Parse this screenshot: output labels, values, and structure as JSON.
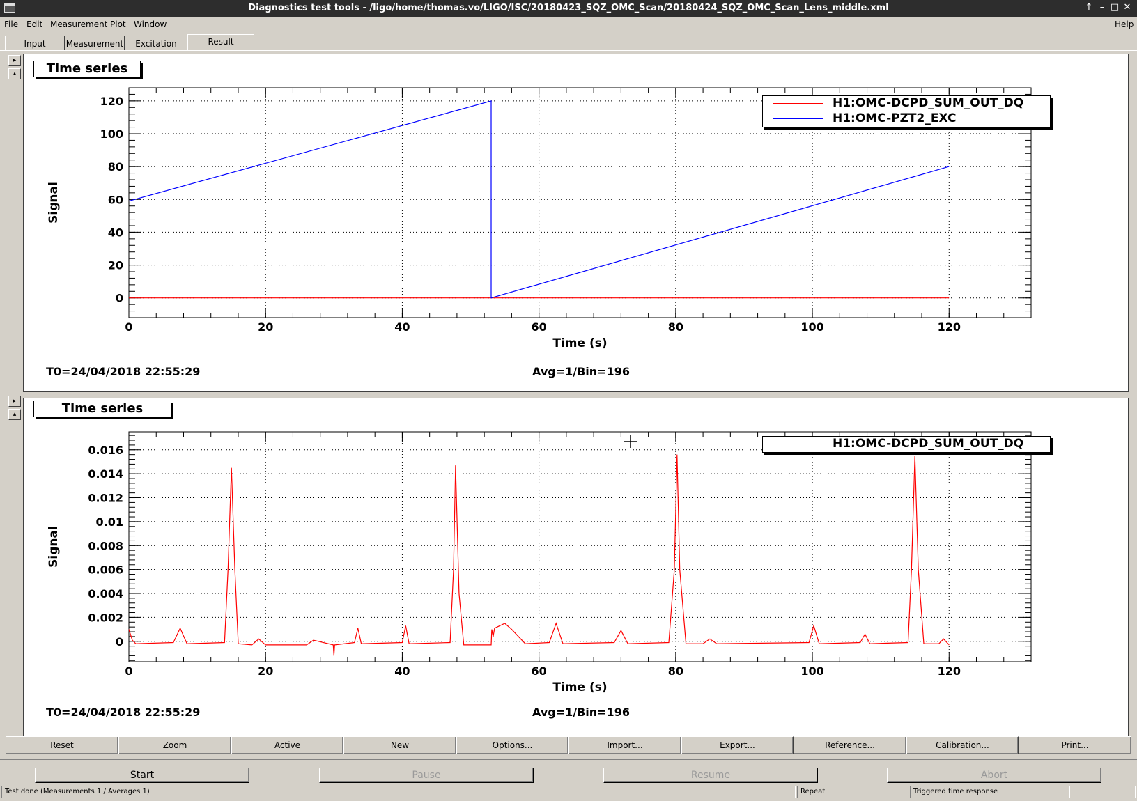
{
  "window": {
    "title": "Diagnostics test tools - /ligo/home/thomas.vo/LIGO/ISC/20180423_SQZ_OMC_Scan/20180424_SQZ_OMC_Scan_Lens_middle.xml",
    "controls": [
      "↑",
      "–",
      "□",
      "✕"
    ]
  },
  "menu": {
    "items": [
      "File",
      "Edit",
      "Measurement",
      "Plot",
      "Window"
    ],
    "help": "Help"
  },
  "tabs": [
    {
      "label": "Input",
      "active": false
    },
    {
      "label": "Measurement",
      "active": false
    },
    {
      "label": "Excitation",
      "active": false
    },
    {
      "label": "Result",
      "active": true
    }
  ],
  "side_buttons": {
    "expand": "▸",
    "collapse": "▴"
  },
  "plots": [
    {
      "pad_title": "Time series",
      "footer_left": "T0=24/04/2018 22:55:29",
      "footer_center": "Avg=1/Bin=196",
      "legend": [
        "H1:OMC-DCPD_SUM_OUT_DQ",
        "H1:OMC-PZT2_EXC"
      ]
    },
    {
      "pad_title": "Time series",
      "footer_left": "T0=24/04/2018 22:55:29",
      "footer_center": "Avg=1/Bin=196",
      "legend": [
        "H1:OMC-DCPD_SUM_OUT_DQ"
      ]
    }
  ],
  "chart_data": [
    {
      "type": "line",
      "title": "Time series",
      "xlabel": "Time (s)",
      "ylabel": "Signal",
      "xlim": [
        0,
        132
      ],
      "ylim": [
        -12,
        128
      ],
      "xticks": [
        0,
        20,
        40,
        60,
        80,
        100,
        120
      ],
      "yticks": [
        0,
        20,
        40,
        60,
        80,
        100,
        120
      ],
      "grid": true,
      "legend_position": "top-right",
      "series": [
        {
          "name": "H1:OMC-DCPD_SUM_OUT_DQ",
          "color": "#ff0000",
          "x": [
            0,
            120
          ],
          "y": [
            0,
            0
          ]
        },
        {
          "name": "H1:OMC-PZT2_EXC",
          "color": "#0000ff",
          "x": [
            0,
            53,
            53,
            120
          ],
          "y": [
            59,
            120,
            0,
            80
          ]
        }
      ]
    },
    {
      "type": "line",
      "title": "Time series",
      "xlabel": "Time (s)",
      "ylabel": "Signal",
      "xlim": [
        0,
        132
      ],
      "ylim": [
        -0.0017,
        0.0175
      ],
      "xticks": [
        0,
        20,
        40,
        60,
        80,
        100,
        120
      ],
      "yticks": [
        0,
        0.002,
        0.004,
        0.006,
        0.008,
        0.01,
        0.012,
        0.014,
        0.016
      ],
      "ytick_labels": [
        "0",
        "0.002",
        "0.004",
        "0.006",
        "0.008",
        "0.01",
        "0.012",
        "0.014",
        "0.016"
      ],
      "grid": true,
      "legend_position": "top-right",
      "series": [
        {
          "name": "H1:OMC-DCPD_SUM_OUT_DQ",
          "color": "#ff0000",
          "x": [
            0,
            0.5,
            1,
            6.5,
            7.5,
            8.5,
            14,
            14.5,
            15,
            15.5,
            16,
            18,
            19,
            20,
            26,
            27,
            29.9,
            30,
            30.1,
            33,
            33.5,
            34,
            40,
            40.5,
            41,
            47,
            47.5,
            47.8,
            48.3,
            49,
            53,
            53.1,
            53.3,
            53.5,
            55,
            56,
            58,
            61.5,
            62.5,
            63.5,
            71,
            72,
            73,
            79,
            79.8,
            80.2,
            80.6,
            81.5,
            84,
            85,
            86,
            99.5,
            100.2,
            101,
            107,
            107.7,
            108.4,
            114,
            114.5,
            115,
            115.5,
            116.3,
            118.5,
            119.2,
            120
          ],
          "y": [
            0.001,
            0.0001,
            -0.0002,
            -0.0001,
            0.0011,
            -0.0002,
            -0.0001,
            0.006,
            0.0145,
            0.006,
            -0.0002,
            -0.0003,
            0.0002,
            -0.0003,
            -0.0003,
            0.0001,
            -0.0003,
            -0.0012,
            -0.0003,
            -0.0001,
            0.0011,
            -0.0002,
            -0.0001,
            0.0013,
            -0.0002,
            -0.0001,
            0.006,
            0.0147,
            0.004,
            -0.0003,
            -0.0003,
            0.001,
            0.0004,
            0.0011,
            0.0015,
            0.001,
            -0.0002,
            -0.0001,
            0.0015,
            -0.0002,
            -0.0001,
            0.0009,
            -0.0002,
            -0.0001,
            0.006,
            0.0156,
            0.006,
            -0.0002,
            -0.0002,
            0.0002,
            -0.0002,
            -0.0001,
            0.0013,
            -0.0002,
            -0.0001,
            0.0006,
            -0.0002,
            -0.0001,
            0.006,
            0.0155,
            0.006,
            -0.0002,
            -0.0002,
            0.0002,
            -0.0003
          ]
        }
      ]
    }
  ],
  "toolbar": [
    "Reset",
    "Zoom",
    "Active",
    "New",
    "Options...",
    "Import...",
    "Export...",
    "Reference...",
    "Calibration...",
    "Print..."
  ],
  "actions": [
    {
      "label": "Start",
      "enabled": true
    },
    {
      "label": "Pause",
      "enabled": false
    },
    {
      "label": "Resume",
      "enabled": false
    },
    {
      "label": "Abort",
      "enabled": false
    }
  ],
  "status": {
    "main": "Test done (Measurements 1 / Averages 1)",
    "mode": "Repeat",
    "type": "Triggered time response"
  }
}
